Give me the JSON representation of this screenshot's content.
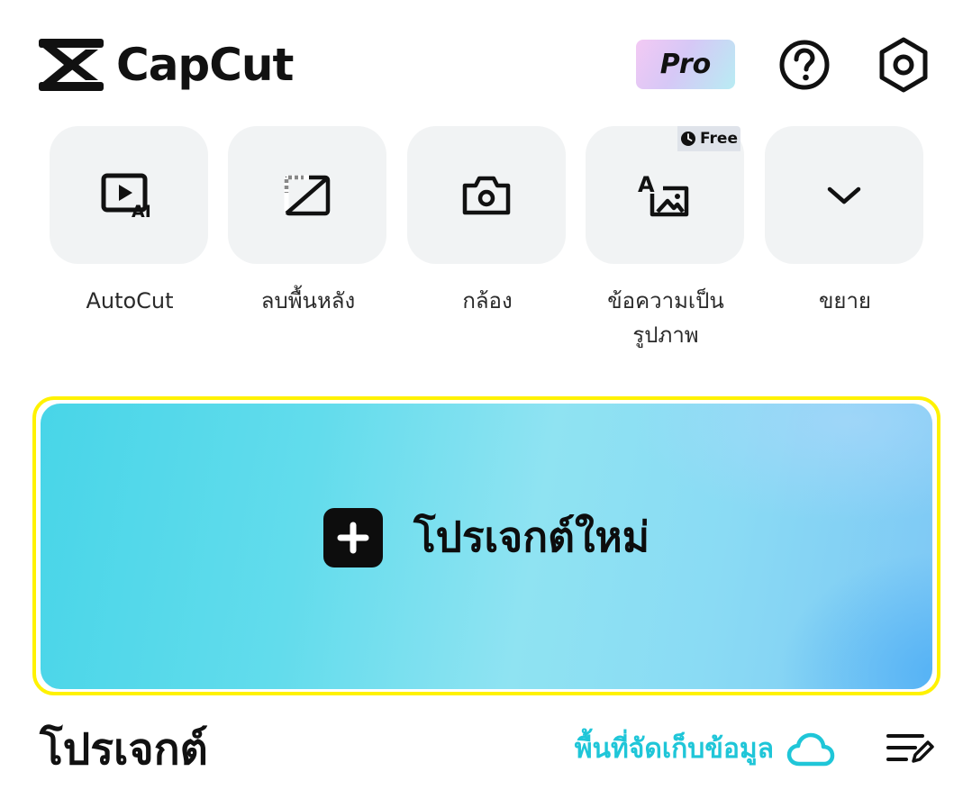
{
  "header": {
    "app_name": "CapCut",
    "pro_label": "Pro"
  },
  "tools": [
    {
      "label": "AutoCut",
      "icon": "autocut-ai-icon"
    },
    {
      "label": "ลบพื้นหลัง",
      "icon": "remove-background-icon"
    },
    {
      "label": "กล้อง",
      "icon": "camera-icon"
    },
    {
      "label": "ข้อความเป็นรูปภาพ",
      "icon": "text-to-image-icon",
      "badge": "Free"
    },
    {
      "label": "ขยาย",
      "icon": "chevron-down-icon"
    }
  ],
  "new_project": {
    "label": "โปรเจกต์ใหม่"
  },
  "projects": {
    "title": "โปรเจกต์",
    "storage_label": "พื้นที่จัดเก็บข้อมูล"
  },
  "colors": {
    "accent": "#1fc6d8",
    "highlight_outline": "#fff200",
    "tile_background": "#f1f3f4"
  }
}
